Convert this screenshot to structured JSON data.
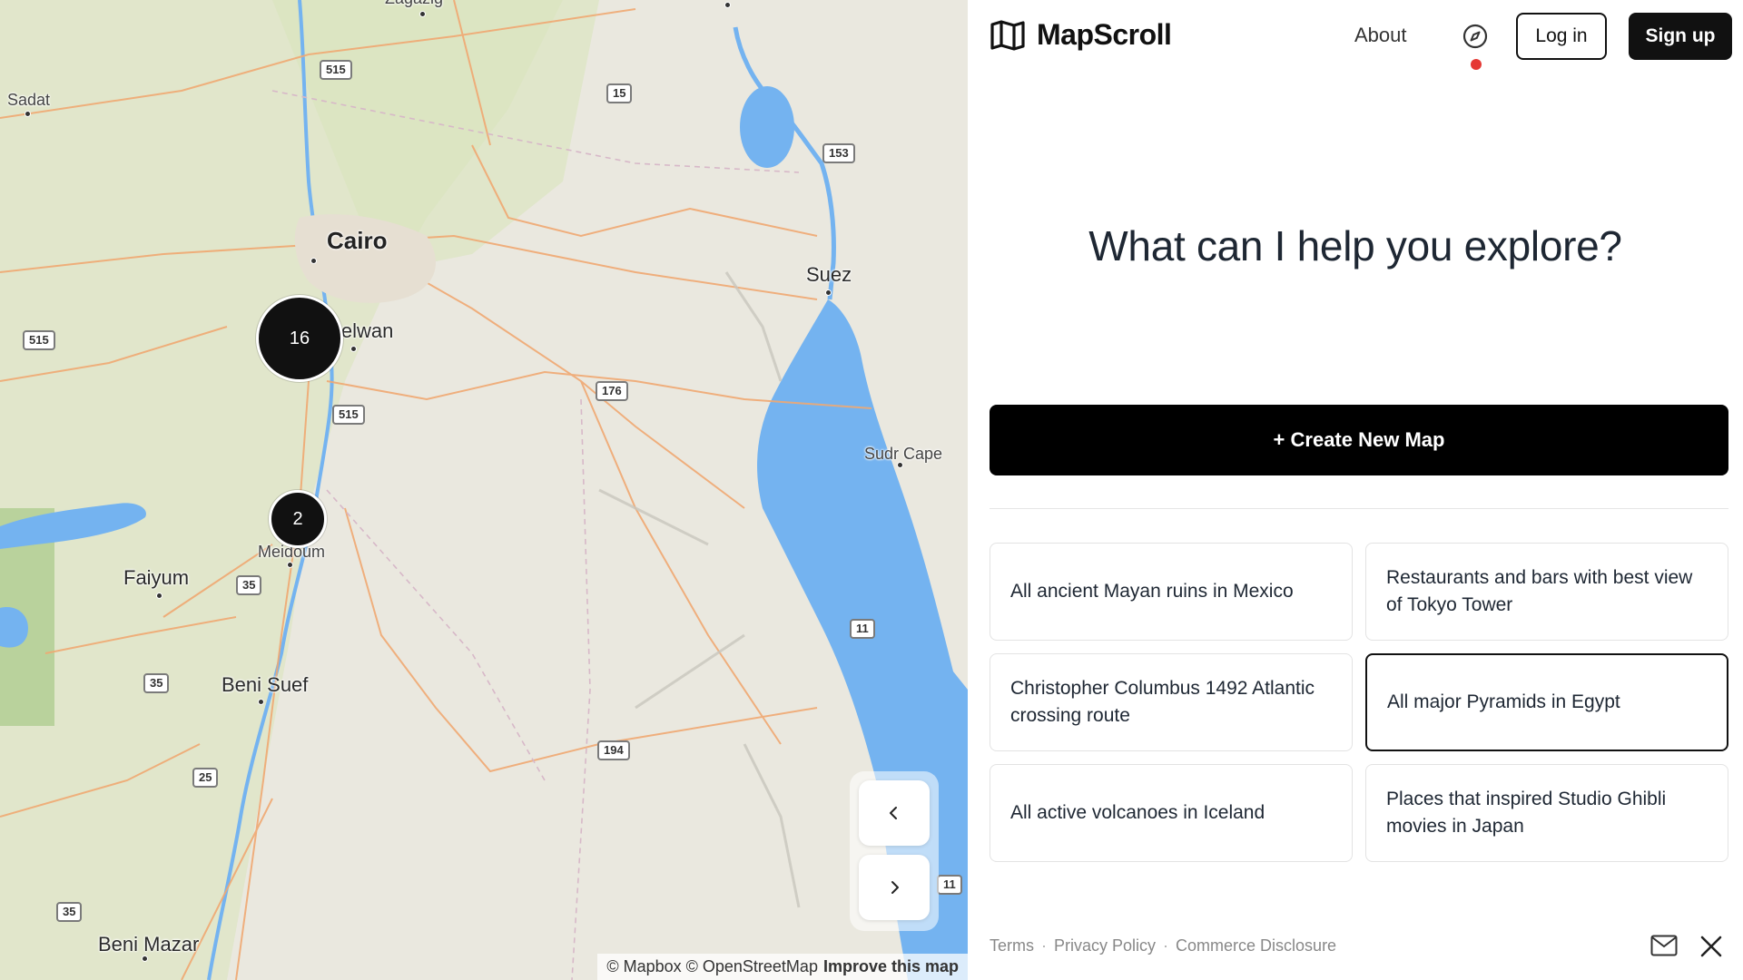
{
  "map": {
    "places": [
      {
        "name": "Zagazig",
        "cls": "sm"
      },
      {
        "name": "Sadat",
        "cls": "sm"
      },
      {
        "name": "Cairo",
        "cls": "big"
      },
      {
        "name": "Helwan",
        "cls": "med"
      },
      {
        "name": "Suez",
        "cls": "med"
      },
      {
        "name": "Sudr Cape",
        "cls": "sm"
      },
      {
        "name": "Meidoum",
        "cls": "sm"
      },
      {
        "name": "Faiyum",
        "cls": "med"
      },
      {
        "name": "Beni Suef",
        "cls": "med"
      },
      {
        "name": "Beni Mazar",
        "cls": "med"
      }
    ],
    "shields": [
      "515",
      "15",
      "153",
      "515",
      "176",
      "515",
      "35",
      "35",
      "11",
      "25",
      "194",
      "35",
      "11"
    ],
    "clusters": [
      {
        "count": "16"
      },
      {
        "count": "2"
      }
    ],
    "nav": {
      "prev_icon": "chevron-left-icon",
      "next_icon": "chevron-right-icon"
    },
    "attribution": {
      "text": "© Mapbox © OpenStreetMap",
      "improve": "Improve this map"
    }
  },
  "header": {
    "logo_text": "MapScroll",
    "about": "About",
    "login": "Log in",
    "signup": "Sign up",
    "notification_color": "#e53935"
  },
  "hero": {
    "title": "What can I help you explore?"
  },
  "create_button": "+ Create New Map",
  "suggestions": [
    {
      "label": "All ancient Mayan ruins in Mexico",
      "selected": false
    },
    {
      "label": "Restaurants and bars with best view of Tokyo Tower",
      "selected": false
    },
    {
      "label": "Christopher Columbus 1492 Atlantic crossing route",
      "selected": false
    },
    {
      "label": "All major Pyramids in Egypt",
      "selected": true
    },
    {
      "label": "All active volcanoes in Iceland",
      "selected": false
    },
    {
      "label": "Places that inspired Studio Ghibli movies in Japan",
      "selected": false
    }
  ],
  "footer": {
    "terms": "Terms",
    "privacy": "Privacy Policy",
    "commerce": "Commerce Disclosure",
    "separator": "·"
  },
  "colors": {
    "water": "#74b3f0",
    "land": "#e9e7df",
    "green": "#d4e3b8",
    "road": "#f0a872",
    "accent": "#111111"
  }
}
